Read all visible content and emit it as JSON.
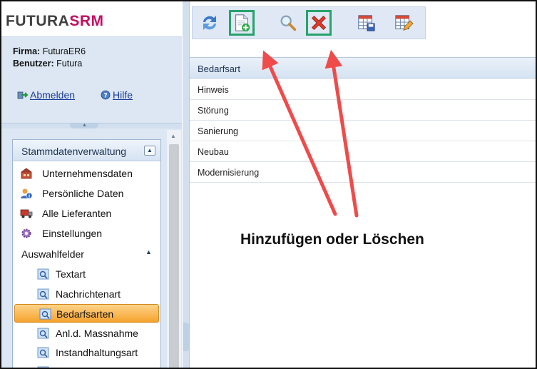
{
  "brand": {
    "part1": "FUTURA",
    "part2": "SRM"
  },
  "user": {
    "firm_label": "Firma:",
    "firm_value": "FuturaER6",
    "user_label": "Benutzer:",
    "user_value": "Futura"
  },
  "links": {
    "logout": "Abmelden",
    "help": "Hilfe"
  },
  "nav": {
    "title": "Stammdatenverwaltung",
    "collapse_icon": "chevron-up-icon",
    "items": [
      {
        "label": "Unternehmensdaten",
        "icon": "building-icon"
      },
      {
        "label": "Persönliche Daten",
        "icon": "person-info-icon"
      },
      {
        "label": "Alle Lieferanten",
        "icon": "truck-icon"
      },
      {
        "label": "Einstellungen",
        "icon": "gear-icon"
      }
    ],
    "group": {
      "label": "Auswahlfelder",
      "icon": "triangle-up-icon"
    },
    "subitems": [
      {
        "label": "Textart",
        "active": false
      },
      {
        "label": "Nachrichtenart",
        "active": false
      },
      {
        "label": "Bedarfsarten",
        "active": true
      },
      {
        "label": "Anl.d. Massnahme",
        "active": false
      },
      {
        "label": "Instandhaltungsart",
        "active": false
      }
    ]
  },
  "toolbar": {
    "buttons": [
      {
        "name": "refresh",
        "icon": "refresh-icon",
        "highlighted": false
      },
      {
        "name": "add",
        "icon": "add-document-icon",
        "highlighted": true
      },
      {
        "name": "search",
        "icon": "magnifier-icon",
        "highlighted": false
      },
      {
        "name": "delete",
        "icon": "delete-x-icon",
        "highlighted": true
      },
      {
        "name": "save-layout",
        "icon": "table-save-icon",
        "highlighted": false
      },
      {
        "name": "edit-layout",
        "icon": "table-edit-icon",
        "highlighted": false
      }
    ]
  },
  "grid": {
    "header": "Bedarfsart",
    "rows": [
      "Hinweis",
      "Störung",
      "Sanierung",
      "Neubau",
      "Modernisierung"
    ]
  },
  "annotation": {
    "text": "Hinzufügen oder Löschen",
    "arrow_color": "#ef4b4b",
    "highlight_color": "#27a36b"
  },
  "colors": {
    "brand_pink": "#c40e5e",
    "panel_blue": "#dce7f3",
    "active_orange": "#f6a22c"
  }
}
